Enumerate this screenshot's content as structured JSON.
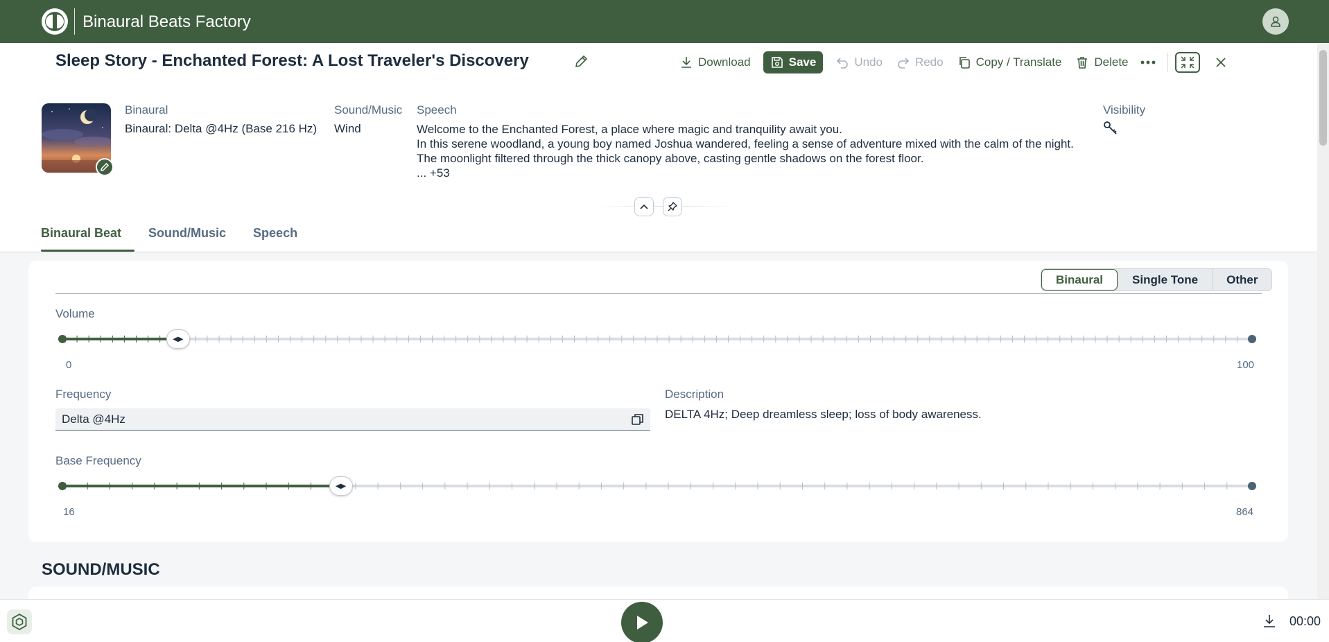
{
  "app": {
    "title": "Binaural Beats Factory"
  },
  "header": {
    "title": "Sleep Story - Enchanted Forest: A Lost Traveler's Discovery",
    "toolbar": {
      "download": "Download",
      "save": "Save",
      "undo": "Undo",
      "redo": "Redo",
      "copy_translate": "Copy / Translate",
      "delete": "Delete"
    },
    "meta": {
      "binaural_label": "Binaural",
      "binaural_value": "Binaural: Delta @4Hz (Base 216 Hz)",
      "sound_label": "Sound/Music",
      "sound_value": "Wind",
      "speech_label": "Speech",
      "speech_lines": [
        "Welcome to the Enchanted Forest, a place where magic and tranquility await you.",
        "In this serene woodland, a young boy named Joshua wandered, feeling a sense of adventure mixed with the calm of the night.",
        "The moonlight filtered through the thick canopy above, casting gentle shadows on the forest floor.",
        "... +53"
      ],
      "visibility_label": "Visibility"
    }
  },
  "tabs": [
    "Binaural Beat",
    "Sound/Music",
    "Speech"
  ],
  "binaural": {
    "modes": [
      "Binaural",
      "Single Tone",
      "Other"
    ],
    "selected_mode": "Binaural",
    "volume": {
      "label": "Volume",
      "min": "0",
      "max": "100",
      "value": 10
    },
    "frequency": {
      "label": "Frequency",
      "value": "Delta @4Hz"
    },
    "description": {
      "label": "Description",
      "value": "DELTA 4Hz; Deep dreamless sleep; loss of body awareness."
    },
    "base_frequency": {
      "label": "Base Frequency",
      "min": "16",
      "max": "864",
      "value": 216
    }
  },
  "sound_section": {
    "title": "SOUND/MUSIC"
  },
  "player": {
    "time": "00:00"
  },
  "colors": {
    "brand": "#3f5e3f",
    "text": "#1d2d3e",
    "muted": "#556b82"
  }
}
